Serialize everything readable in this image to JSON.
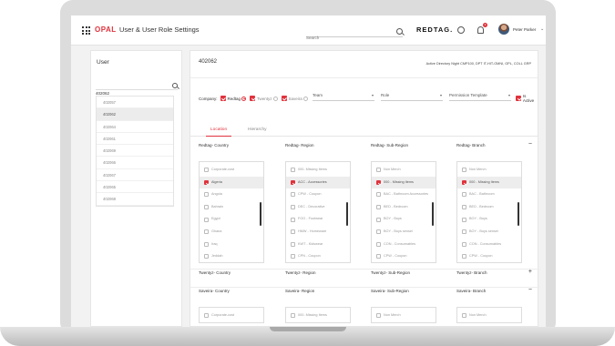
{
  "header": {
    "logo": "OPAL",
    "title": "User & User Role Settings",
    "search_placeholder": "Search",
    "brand": "REDTAG.",
    "notification_count": "3",
    "user_name": "Peter Parker",
    "user_chevron": "⌄"
  },
  "user_panel": {
    "title": "User",
    "search_value": "402062",
    "items": [
      "402057",
      "402062",
      "402064",
      "402061",
      "402069",
      "402066",
      "402067",
      "402065",
      "402068"
    ],
    "selected_index": 1
  },
  "detail": {
    "user_id": "402062",
    "tags": "Active Directory Night CMP100, DPT IT-HIT-OMNI, GPL, COLL GRP",
    "company_label": "Company:",
    "companies": [
      {
        "label": "Redtag",
        "checked": true,
        "radio": true
      },
      {
        "label": "Twentyz",
        "checked": true,
        "radio": false
      },
      {
        "label": "Saveira",
        "checked": true,
        "radio": false
      }
    ],
    "selects": {
      "team": "Team",
      "role": "Role",
      "permission": "Permission Template"
    },
    "is_active_label": "Is Active",
    "tabs": [
      "Location",
      "Hierarchy"
    ],
    "active_tab": 0
  },
  "sections": [
    {
      "headers": [
        "Redtag- Country",
        "Redtag- Region",
        "Redtag- Sub-Region",
        "Redtag- Branch"
      ],
      "toggle": "−",
      "expanded": true,
      "columns": [
        {
          "items": [
            "Corporate-cost",
            "Algeria",
            "Angola",
            "Bahrain",
            "Egypt",
            "Ghana",
            "Iraq",
            "Jeddah"
          ],
          "selected": 1
        },
        {
          "items": [
            "000- Missing Items",
            "ACC - Accessories",
            "CPW - Coupon",
            "DEC - Decorative",
            "FOO - Footwear",
            "HMW - Homeware",
            "KWT - Kidswear",
            "CPN - Coupon"
          ],
          "selected": 1
        },
        {
          "items": [
            "Non Merch",
            "000 - Missing Items",
            "BAC - Bathroom Accessories",
            "BED - Bedroom",
            "BOY - Boys",
            "BOY - Boys sensei",
            "CON - Consumables",
            "CPW - Coupon"
          ],
          "selected": 1
        },
        {
          "items": [
            "Non Merch",
            "000 - Missing Items",
            "BAC - Bathroom",
            "BED - Bedroom",
            "BOY - Boys",
            "BOY - Boys sensei",
            "CON - Consumables",
            "CPW - Coupon"
          ],
          "selected": 1
        }
      ]
    },
    {
      "headers": [
        "Twentyz- Country",
        "Twentyz- Region",
        "Twentyz- Sub-Region",
        "Twentyz- Branch"
      ],
      "toggle": "+",
      "expanded": false
    },
    {
      "headers": [
        "Saveira- Country",
        "Saveira- Region",
        "Saveira- Sub-Region",
        "Saveira- Branch"
      ],
      "toggle": "−",
      "expanded": true,
      "columns": [
        {
          "items": [
            "Corporate-cost"
          ],
          "selected": -1
        },
        {
          "items": [
            "000- Missing Items"
          ],
          "selected": -1
        },
        {
          "items": [
            "Non Merch"
          ],
          "selected": -1
        },
        {
          "items": [
            "Non Merch"
          ],
          "selected": -1
        }
      ]
    }
  ]
}
